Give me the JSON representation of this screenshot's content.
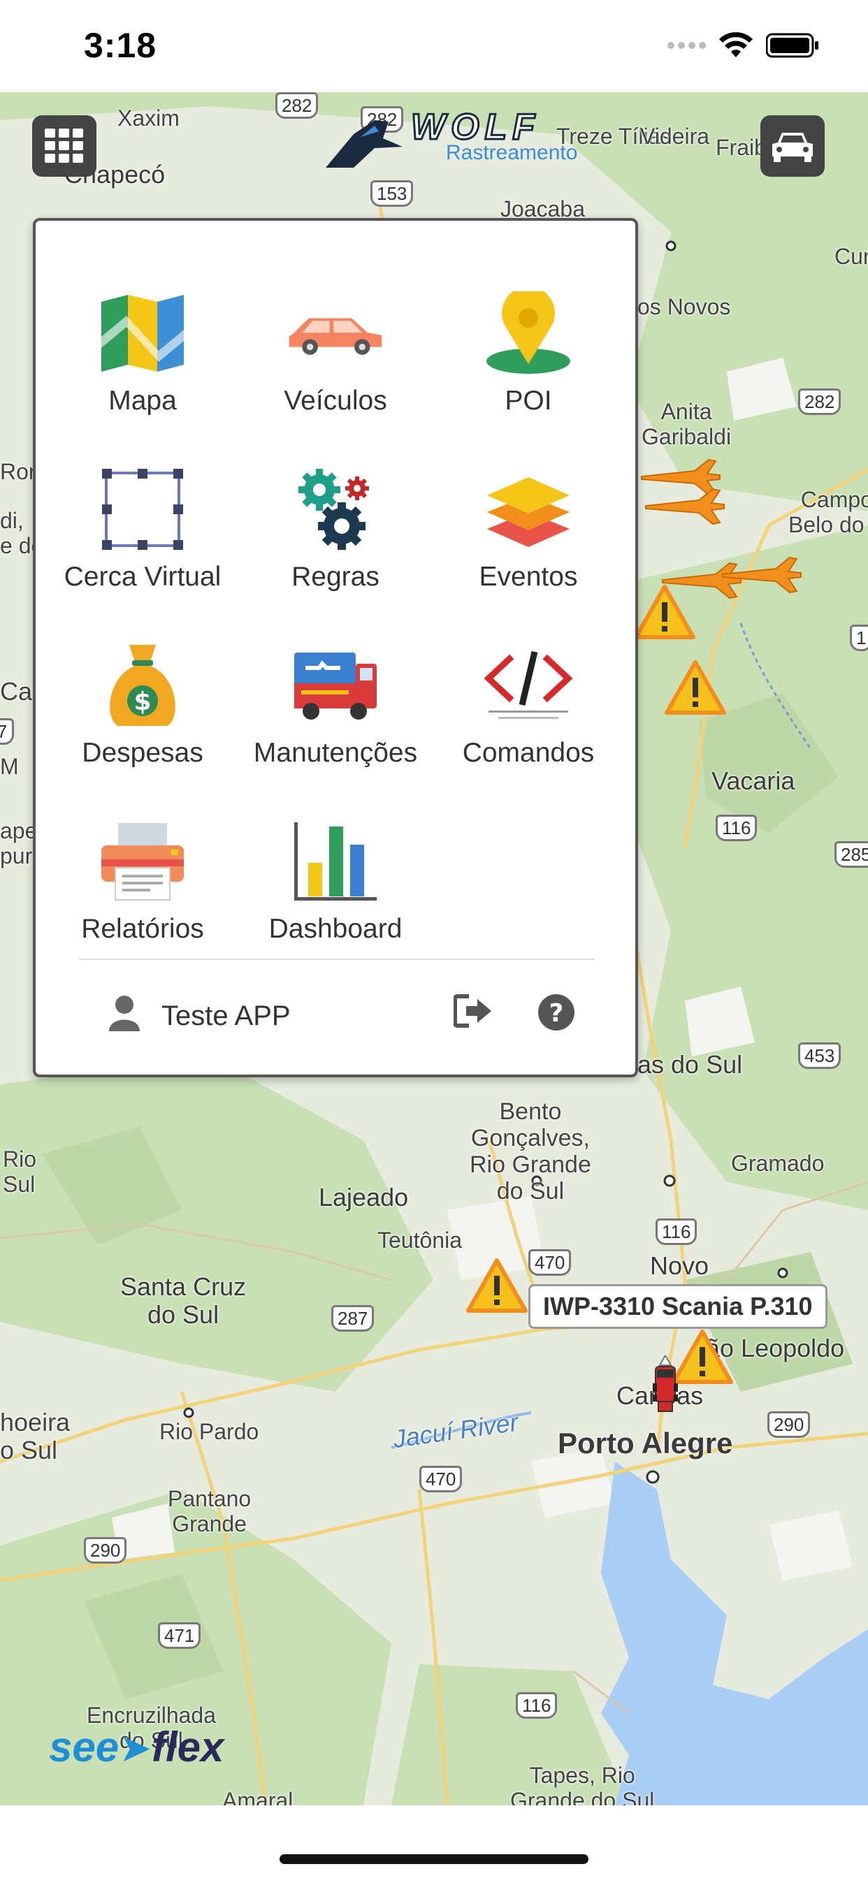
{
  "status_bar": {
    "time": "3:18",
    "icons": [
      "signal-icon",
      "wifi-icon",
      "battery-icon"
    ]
  },
  "header": {
    "brand_name": "WOLF",
    "brand_subtitle": "Rastreamento",
    "menu_icon": "grid-icon",
    "vehicle_icon": "car-icon"
  },
  "menu": {
    "items": [
      {
        "label": "Mapa",
        "icon": "map-icon"
      },
      {
        "label": "Veículos",
        "icon": "vehicle-icon"
      },
      {
        "label": "POI",
        "icon": "poi-pin-icon"
      },
      {
        "label": "Cerca Virtual",
        "icon": "geofence-icon"
      },
      {
        "label": "Regras",
        "icon": "gears-icon"
      },
      {
        "label": "Eventos",
        "icon": "layers-icon"
      },
      {
        "label": "Despesas",
        "icon": "money-bag-icon"
      },
      {
        "label": "Manutenções",
        "icon": "maintenance-truck-icon"
      },
      {
        "label": "Comandos",
        "icon": "code-icon"
      },
      {
        "label": "Relatórios",
        "icon": "printer-icon"
      },
      {
        "label": "Dashboard",
        "icon": "bar-chart-icon"
      }
    ],
    "user": {
      "name": "Teste APP",
      "icon": "user-icon"
    },
    "logout_icon": "logout-icon",
    "help_icon": "help-icon"
  },
  "map": {
    "places": {
      "xaxim": "Xaxim",
      "chapeco": "Chapecó",
      "treze_tilias": "Treze Tílias",
      "videira": "Videira",
      "fraib": "Fraib",
      "joacaba": "Joacaba",
      "cur": "Cur",
      "os_novos": "os Novos",
      "anita_garibaldi": "Anita\nGaribaldi",
      "campo_belo": "Campo\nBelo do S",
      "vacaria": "Vacaria",
      "as_do_sul": "as do Sul",
      "bento": "Bento\nGonçalves,\nRio Grande\ndo Sul",
      "gramado": "Gramado",
      "lajeado": "Lajeado",
      "teutonia": "Teutônia",
      "novo": "Novo",
      "sao_leopoldo": "ão Leopoldo",
      "santa_cruz": "Santa Cruz\ndo Sul",
      "canoas": "Canoas",
      "porto_alegre": "Porto Alegre",
      "rio_pardo": "Rio Pardo",
      "pantano_grande": "Pantano\nGrande",
      "jacui_river": "Jacuí River",
      "encruzilhada": "Encruzilhada\ndo Sul",
      "tapes": "Tapes, Rio\nGrande do Sul",
      "amaral": "Amaral",
      "rio_sul": "Rio\nSul",
      "hoeira": "hoeira\no Sul",
      "left_ron": "Ron",
      "left_di": "di,\ne do",
      "left_car": "Car",
      "left_m": "M",
      "left_ape": "ape\npur"
    },
    "roads": [
      "282",
      "282",
      "153",
      "282",
      "116",
      "285",
      "453",
      "116",
      "470",
      "287",
      "470",
      "290",
      "290",
      "471",
      "116",
      "1",
      "7"
    ],
    "vehicle_label": "IWP-3310 Scania P.310"
  },
  "footer": {
    "logo_see": "see",
    "logo_flex": "flex"
  },
  "colors": {
    "panel_border": "#555555",
    "button_bg": "#444444",
    "map_green": "#cfe3bd",
    "water": "#a9cdf4",
    "warning": "#f7a51c"
  }
}
